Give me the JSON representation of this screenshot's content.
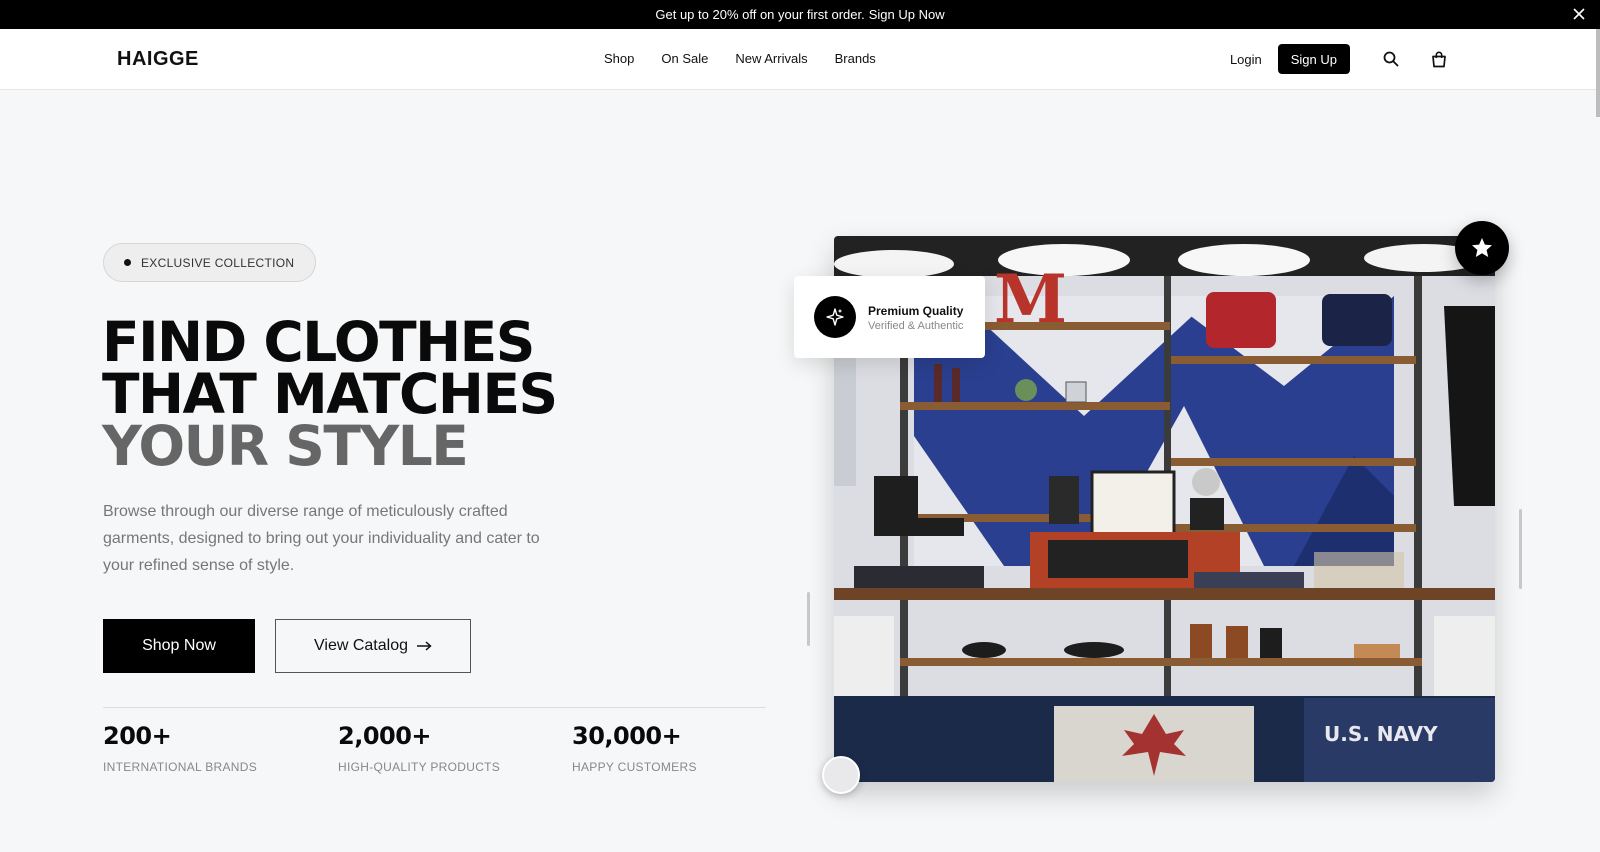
{
  "announcement": {
    "text": "Get up to 20% off on your first order.",
    "link": "Sign Up Now"
  },
  "header": {
    "logo": "HAIGGE",
    "nav": [
      "Shop",
      "On Sale",
      "New Arrivals",
      "Brands"
    ],
    "login": "Login",
    "signup": "Sign Up",
    "icons": [
      "search-icon",
      "cart-icon"
    ]
  },
  "hero": {
    "badge": "EXCLUSIVE COLLECTION",
    "headline": [
      "FIND CLOTHES",
      "THAT MATCHES",
      "YOUR STYLE"
    ],
    "description": "Browse through our diverse range of meticulously crafted garments, designed to bring out your individuality and cater to your refined sense of style.",
    "primary_cta": "Shop Now",
    "secondary_cta": "View Catalog",
    "secondary_cta_icon": "arrow-right-icon",
    "stats": [
      {
        "value": "200+",
        "label": "INTERNATIONAL BRANDS"
      },
      {
        "value": "2,000+",
        "label": "HIGH-QUALITY PRODUCTS"
      },
      {
        "value": "30,000+",
        "label": "HAPPY CUSTOMERS"
      }
    ]
  },
  "feature_card": {
    "title": "Premium Quality",
    "subtitle": "Verified & Authentic",
    "icon": "sparkle-icon"
  },
  "image_labels": {
    "letter": "M",
    "shirt_text": "U.S. NAVY"
  },
  "colors": {
    "accent": "#000000",
    "headline_muted": "#666666",
    "background": "#f6f7f8"
  }
}
